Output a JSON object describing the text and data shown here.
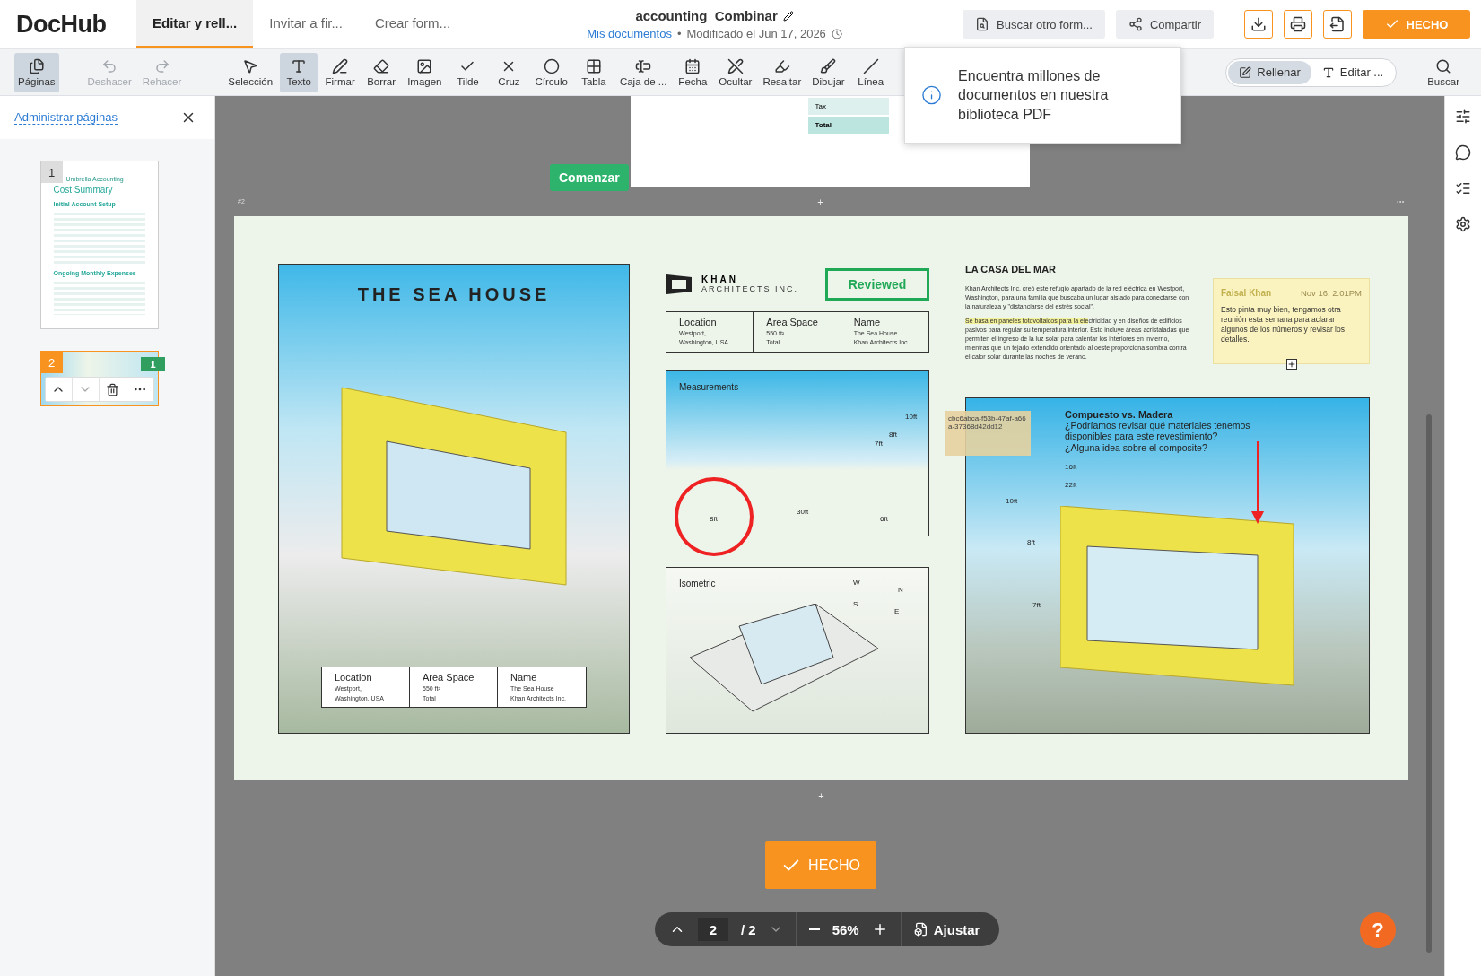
{
  "header": {
    "logo": "DocHub",
    "tabs": [
      {
        "label": "Editar y rell...",
        "selected": true
      },
      {
        "label": "Invitar a fir...",
        "selected": false
      },
      {
        "label": "Crear form...",
        "selected": false
      }
    ],
    "doc_title": "accounting_Combinar",
    "breadcrumb": "Mis documentos",
    "separator": "•",
    "modified": "Modificado el Jun 17, 2026",
    "buttons": [
      "Buscar otro form...",
      "Compartir"
    ],
    "done": "HECHO"
  },
  "toolbar": {
    "tools": [
      {
        "label": "Páginas",
        "selected": true,
        "disabled": false
      },
      {
        "label": "Deshacer",
        "selected": false,
        "disabled": true
      },
      {
        "label": "Rehacer",
        "selected": false,
        "disabled": true
      },
      {
        "label": "Selección",
        "selected": false,
        "disabled": false
      },
      {
        "label": "Texto",
        "selected": true,
        "disabled": false
      },
      {
        "label": "Firmar",
        "selected": false,
        "disabled": false
      },
      {
        "label": "Borrar",
        "selected": false,
        "disabled": false
      },
      {
        "label": "Imagen",
        "selected": false,
        "disabled": false
      },
      {
        "label": "Tilde",
        "selected": false,
        "disabled": false
      },
      {
        "label": "Cruz",
        "selected": false,
        "disabled": false
      },
      {
        "label": "Círculo",
        "selected": false,
        "disabled": false
      },
      {
        "label": "Tabla",
        "selected": false,
        "disabled": false
      },
      {
        "label": "Caja de ...",
        "selected": false,
        "disabled": false
      },
      {
        "label": "Fecha",
        "selected": false,
        "disabled": false
      },
      {
        "label": "Ocultar",
        "selected": false,
        "disabled": false
      },
      {
        "label": "Resaltar",
        "selected": false,
        "disabled": false
      },
      {
        "label": "Dibujar",
        "selected": false,
        "disabled": false
      },
      {
        "label": "Línea",
        "selected": false,
        "disabled": false
      }
    ],
    "modes": [
      {
        "label": "Rellenar",
        "selected": true
      },
      {
        "label": "Editar ...",
        "selected": false
      }
    ],
    "search": "Buscar"
  },
  "sidebar": {
    "title": "Administrar páginas",
    "thumbnails": [
      {
        "number": "1",
        "selected": false,
        "brand": "Umbrella Accounting",
        "heading": "Cost Summary",
        "sections": [
          "Initial Account Setup",
          "Ongoing Monthly Expenses"
        ]
      },
      {
        "number": "2",
        "selected": true,
        "badge": "1"
      }
    ]
  },
  "page1": {
    "rows": [
      "Tax",
      "Total"
    ]
  },
  "start_button": "Comenzar",
  "tooltip": "Encuentra millones de documentos en nuestra biblioteca PDF",
  "page2": {
    "label": "#2",
    "add_marks": [
      "+",
      "+"
    ],
    "poster": {
      "title": "THE SEA HOUSE",
      "table": [
        {
          "head": "Location",
          "lines": [
            "Westport,",
            "Washington, USA"
          ]
        },
        {
          "head": "Area Space",
          "lines": [
            "550 ft²",
            "Total"
          ]
        },
        {
          "head": "Name",
          "lines": [
            "The Sea House",
            "Khan Architects Inc."
          ]
        }
      ]
    },
    "brand": {
      "name": "KHAN",
      "sub": "ARCHITECTS INC."
    },
    "stamp": "Reviewed",
    "table": [
      {
        "head": "Location",
        "lines": [
          "Westport,",
          "Washington, USA"
        ]
      },
      {
        "head": "Area Space",
        "lines": [
          "550 ft²",
          "Total"
        ]
      },
      {
        "head": "Name",
        "lines": [
          "The Sea House",
          "Khan Architects Inc."
        ]
      }
    ],
    "measurements": {
      "title": "Measurements",
      "heights": [
        "10ft",
        "8ft",
        "7ft"
      ],
      "widths": [
        "8ft",
        "30ft",
        "6ft"
      ]
    },
    "isometric": {
      "title": "Isometric",
      "compass": [
        "W",
        "N",
        "S",
        "E"
      ]
    },
    "article": {
      "title": "LA CASA DEL MAR",
      "paragraphs": [
        {
          "text": "Khan Architects Inc. creó este refugio apartado de la red eléctrica en Westport, Washington, para una familia que buscaba un lugar aislado para conectarse con la naturaleza y \"distanciarse del estrés social\"."
        },
        {
          "highlighted": "Se basa en paneles fotovoltaicos para la ele",
          "text": "ctricidad y en diseños de edificios pasivos para regular su temperatura interior. Esto incluye áreas acristaladas que permiten el ingreso de la luz solar para calentar los interiores en invierno, mientras que un tejado extendido orientado al oeste proporciona sombra contra el calor solar durante las noches de verano."
        }
      ]
    },
    "note": {
      "author": "Faisal Khan",
      "date": "Nov 16, 2:01PM",
      "text": "Esto pinta muy bien, tengamos otra reunión esta semana para aclarar algunos de los números y revisar los detalles."
    },
    "sticker": "cbc6abca-f53b-47af-a66a-37368d42dd12",
    "comment": {
      "title": "Compuesto vs. Madera",
      "text": "¿Podríamos revisar qué materiales tenemos disponibles para este revestimiento? ¿Alguna idea sobre el composite?"
    },
    "render_dims": [
      "16ft",
      "22ft",
      "10ft",
      "8ft",
      "7ft"
    ]
  },
  "done_button": "HECHO",
  "pager": {
    "page": "2",
    "total": "/ 2",
    "zoom": "56%",
    "fit": "Ajustar"
  },
  "help": "?"
}
